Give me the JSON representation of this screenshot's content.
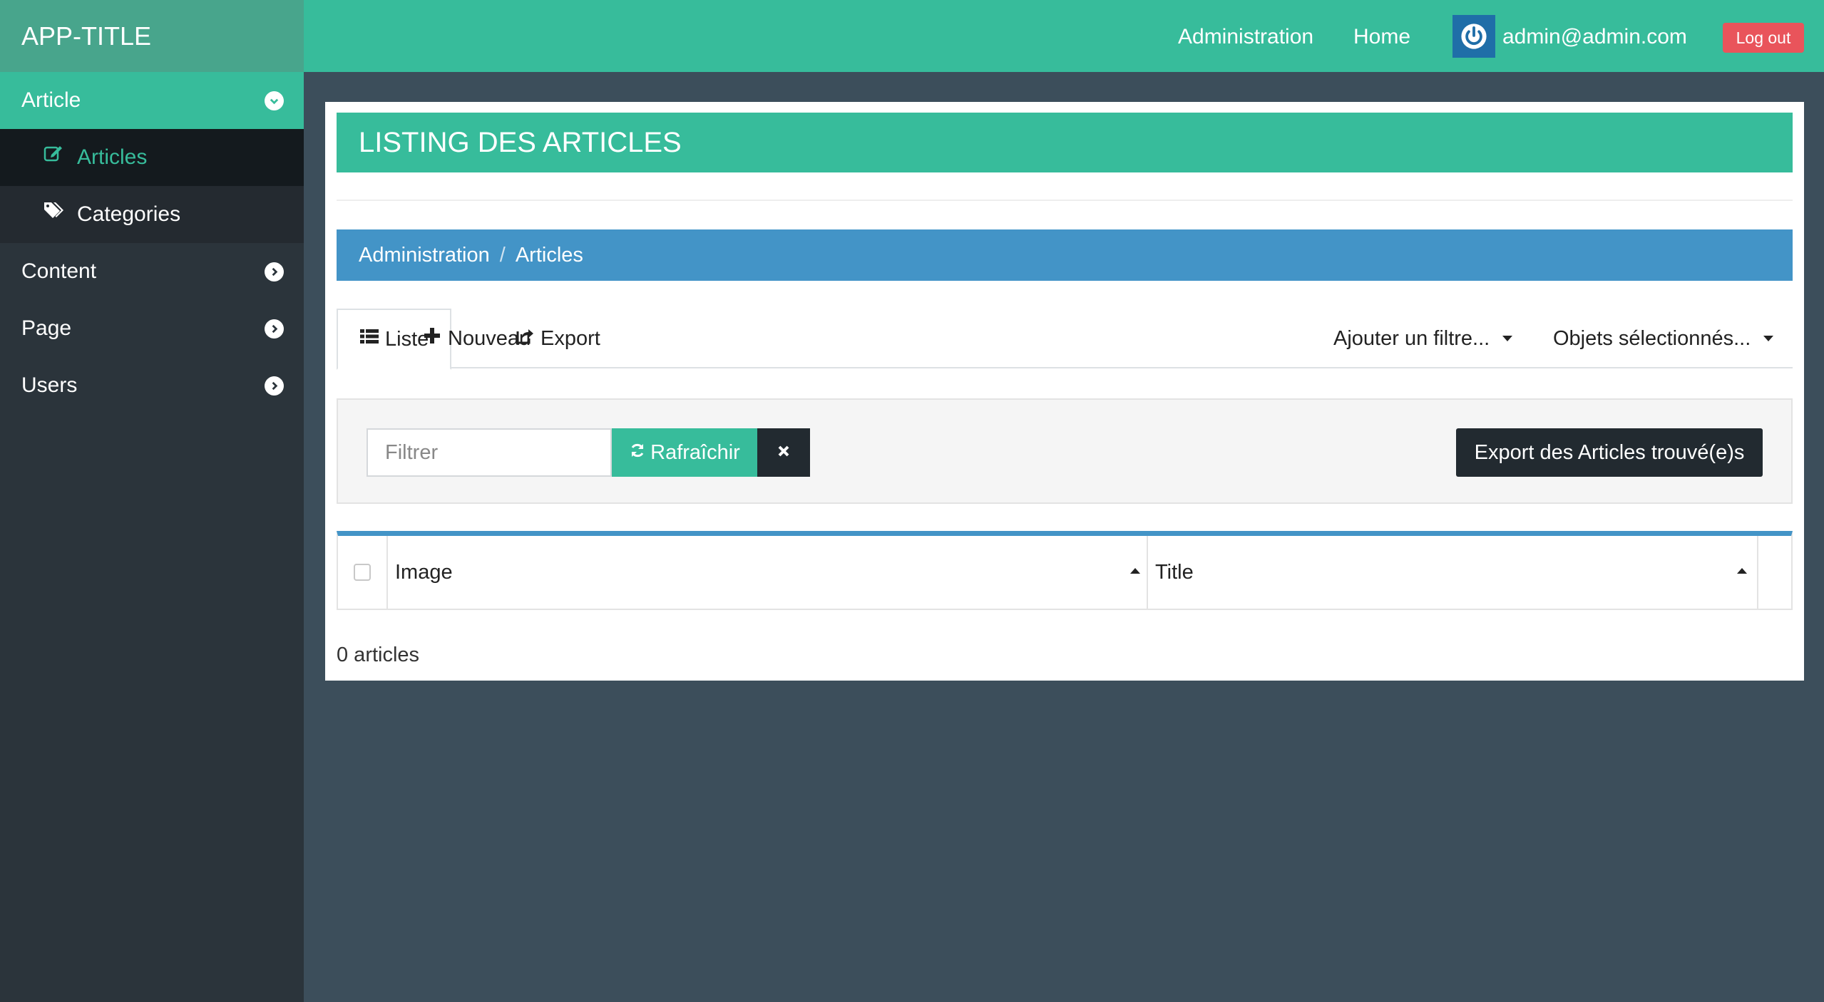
{
  "app": {
    "title": "APP-TITLE"
  },
  "sidebar": {
    "items": [
      {
        "label": "Article",
        "icon": "chevron-down-icon"
      },
      {
        "label": "Articles",
        "icon": "edit-icon"
      },
      {
        "label": "Categories",
        "icon": "tags-icon"
      },
      {
        "label": "Content",
        "icon": "chevron-right-icon"
      },
      {
        "label": "Page",
        "icon": "chevron-right-icon"
      },
      {
        "label": "Users",
        "icon": "chevron-right-icon"
      }
    ]
  },
  "topbar": {
    "administration": "Administration",
    "home": "Home",
    "user_email": "admin@admin.com",
    "logout": "Log out"
  },
  "page": {
    "title": "LISTING DES ARTICLES",
    "breadcrumb": [
      "Administration",
      "Articles"
    ],
    "tabs": {
      "list": "Liste",
      "new": "Nouveau",
      "export": "Export",
      "add_filter": "Ajouter un filtre...",
      "selected": "Objets sélectionnés..."
    },
    "filter": {
      "placeholder": "Filtrer",
      "refresh": "Rafraîchir",
      "export_found": "Export des Articles trouvé(e)s"
    },
    "table": {
      "columns": [
        "Image",
        "Title"
      ]
    },
    "count": "0 articles"
  },
  "colors": {
    "accent": "#37bc9b",
    "brand": "#48a58c",
    "breadcrumb": "#4394c7",
    "sidebar": "#2b343b",
    "background": "#3c4e5b",
    "logout": "#e9545b"
  }
}
